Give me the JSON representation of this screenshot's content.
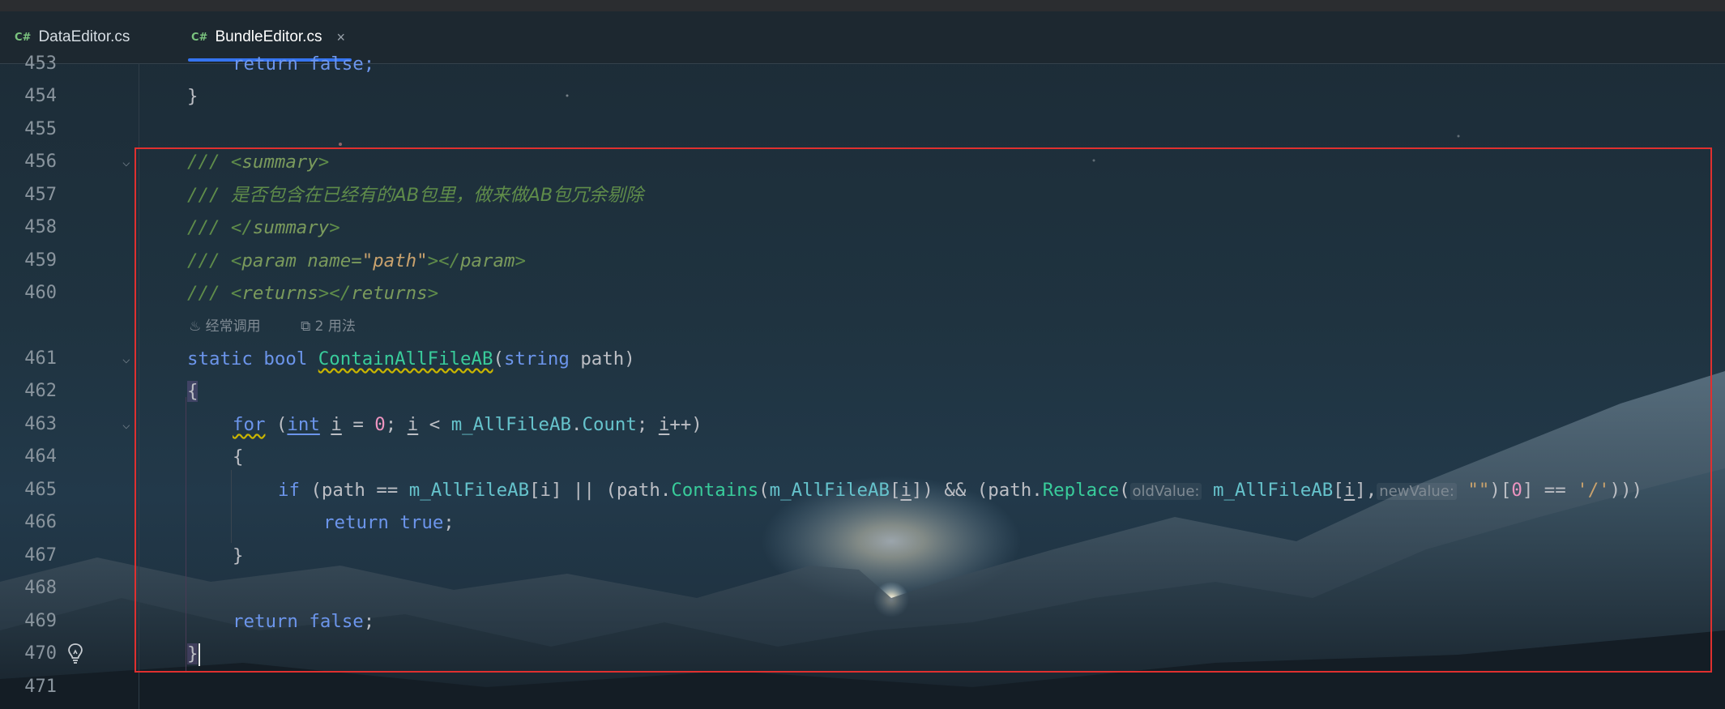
{
  "tabs": [
    {
      "icon": "C#",
      "label": "DataEditor.cs",
      "active": false
    },
    {
      "icon": "C#",
      "label": "BundleEditor.cs",
      "active": true,
      "close": "×"
    }
  ],
  "line_numbers": [
    "453",
    "454",
    "455",
    "456",
    "457",
    "458",
    "459",
    "460",
    "461",
    "462",
    "463",
    "464",
    "465",
    "466",
    "467",
    "468",
    "469",
    "470",
    "471"
  ],
  "inlay": {
    "usage": "经常调用",
    "usages_count": "2 用法"
  },
  "code": {
    "l453": "return false;",
    "l454": "}",
    "l456": {
      "slashes": "/// ",
      "open": "<",
      "tag": "summary",
      "close": ">"
    },
    "l457": {
      "slashes": "/// ",
      "text": "是否包含在已经有的AB包里，做来做AB包冗余剔除"
    },
    "l458": {
      "slashes": "/// ",
      "open": "</",
      "tag": "summary",
      "close": ">"
    },
    "l459": {
      "slashes": "/// ",
      "open": "<",
      "tag": "param",
      "attr": " name=",
      "val": "\"path\"",
      "mid": "></",
      "tag2": "param",
      "close": ">"
    },
    "l460": {
      "slashes": "/// ",
      "open": "<",
      "tag": "returns",
      "mid": "></",
      "tag2": "returns",
      "close": ">"
    },
    "l461": {
      "kw1": "static",
      "kw2": "bool",
      "name": "ContainAllFileAB",
      "open": "(",
      "type": "string",
      "param": " path)"
    },
    "l462": "{",
    "l463": {
      "kw": "for",
      "p1": " (",
      "type": "int",
      "i": "i",
      "eq": " = ",
      "zero": "0",
      "semi": "; ",
      "i2": "i",
      "lt": " < ",
      "field": "m_AllFileAB",
      "dot": ".",
      "count": "Count",
      "semi2": "; ",
      "i3": "i",
      "inc": "++)"
    },
    "l464": "{",
    "l465": {
      "kw": "if",
      "a": " (path == ",
      "f1": "m_AllFileAB",
      "b": "[i] || (path.",
      "contains": "Contains",
      "c": "(",
      "f2": "m_AllFileAB",
      "d": "[",
      "i": "i",
      "e": "]) && (path.",
      "replace": "Replace",
      "g": "(",
      "hint1": "oldValue:",
      "f3": "m_AllFileAB",
      "h": "[",
      "i2": "i",
      "j": "],",
      "hint2": "newValue:",
      "str": "\"\"",
      "k": ")[",
      "zero": "0",
      "l": "] == ",
      "chr": "'/'",
      "m": ")))"
    },
    "l466": {
      "kw": "return",
      "val": "true",
      "semi": ";"
    },
    "l467": "}",
    "l469": {
      "kw": "return",
      "val": "false",
      "semi": ";"
    },
    "l470": "}"
  },
  "colors": {
    "highlight_box": "#e0302f",
    "active_tab_underline": "#3574f0"
  }
}
